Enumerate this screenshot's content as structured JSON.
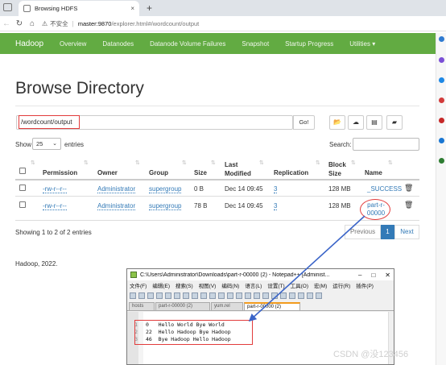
{
  "browser": {
    "tab_title": "Browsing HDFS",
    "tab_close": "×",
    "new_tab": "+",
    "security": "不安全",
    "host": "master:9870",
    "path": "/explorer.html#/wordcount/output"
  },
  "navbar": {
    "brand": "Hadoop",
    "links": [
      "Overview",
      "Datanodes",
      "Datanode Volume Failures",
      "Snapshot",
      "Startup Progress",
      "Utilities ▾"
    ]
  },
  "page": {
    "title": "Browse Directory",
    "path_value": "/wordcount/output",
    "go_label": "Go!",
    "show_label": "Show",
    "entries_value": "25",
    "entries_label": "entries",
    "search_label": "Search:",
    "showing_text": "Showing 1 to 2 of 2 entries",
    "previous_label": "Previous",
    "current_page": "1",
    "next_label": "Next",
    "footer": "Hadoop, 2022."
  },
  "table": {
    "headers": [
      "Permission",
      "Owner",
      "Group",
      "Size",
      "Last Modified",
      "Replication",
      "Block Size",
      "Name"
    ],
    "rows": [
      {
        "permission": "-rw-r--r--",
        "owner": "Administrator",
        "group": "supergroup",
        "size": "0 B",
        "modified": "Dec 14 09:45",
        "replication": "3",
        "block": "128 MB",
        "name": "_SUCCESS"
      },
      {
        "permission": "-rw-r--r--",
        "owner": "Administrator",
        "group": "supergroup",
        "size": "78 B",
        "modified": "Dec 14 09:45",
        "replication": "3",
        "block": "128 MB",
        "name": "part-r-00000"
      }
    ]
  },
  "notepad": {
    "title": "C:\\Users\\Administrator\\Downloads\\part-r-00000 (2) - Notepad++ [Administ...",
    "menu": [
      "文件(F)",
      "编辑(E)",
      "搜索(S)",
      "视图(V)",
      "编码(N)",
      "语言(L)",
      "设置(T)",
      "工具(O)",
      "宏(M)",
      "运行(R)",
      "插件(P)"
    ],
    "file_tabs": [
      "hosts",
      "part-r-00000 (2)",
      "yum.rel",
      "part-r-00000 (2)"
    ],
    "active_tab_index": 3,
    "line_numbers": [
      "1",
      "2",
      "3"
    ],
    "lines": [
      "0   Hello World Bye World",
      "22  Hello Hadoop Bye Hadoop",
      "46  Bye Hadoop Hello Hadoop"
    ]
  },
  "watermark": "CSDN @没123456",
  "colors": {
    "navbar": "#62ab42",
    "link": "#337ab7",
    "annotation_red": "#e23c3c",
    "arrow": "#3a64c8"
  }
}
